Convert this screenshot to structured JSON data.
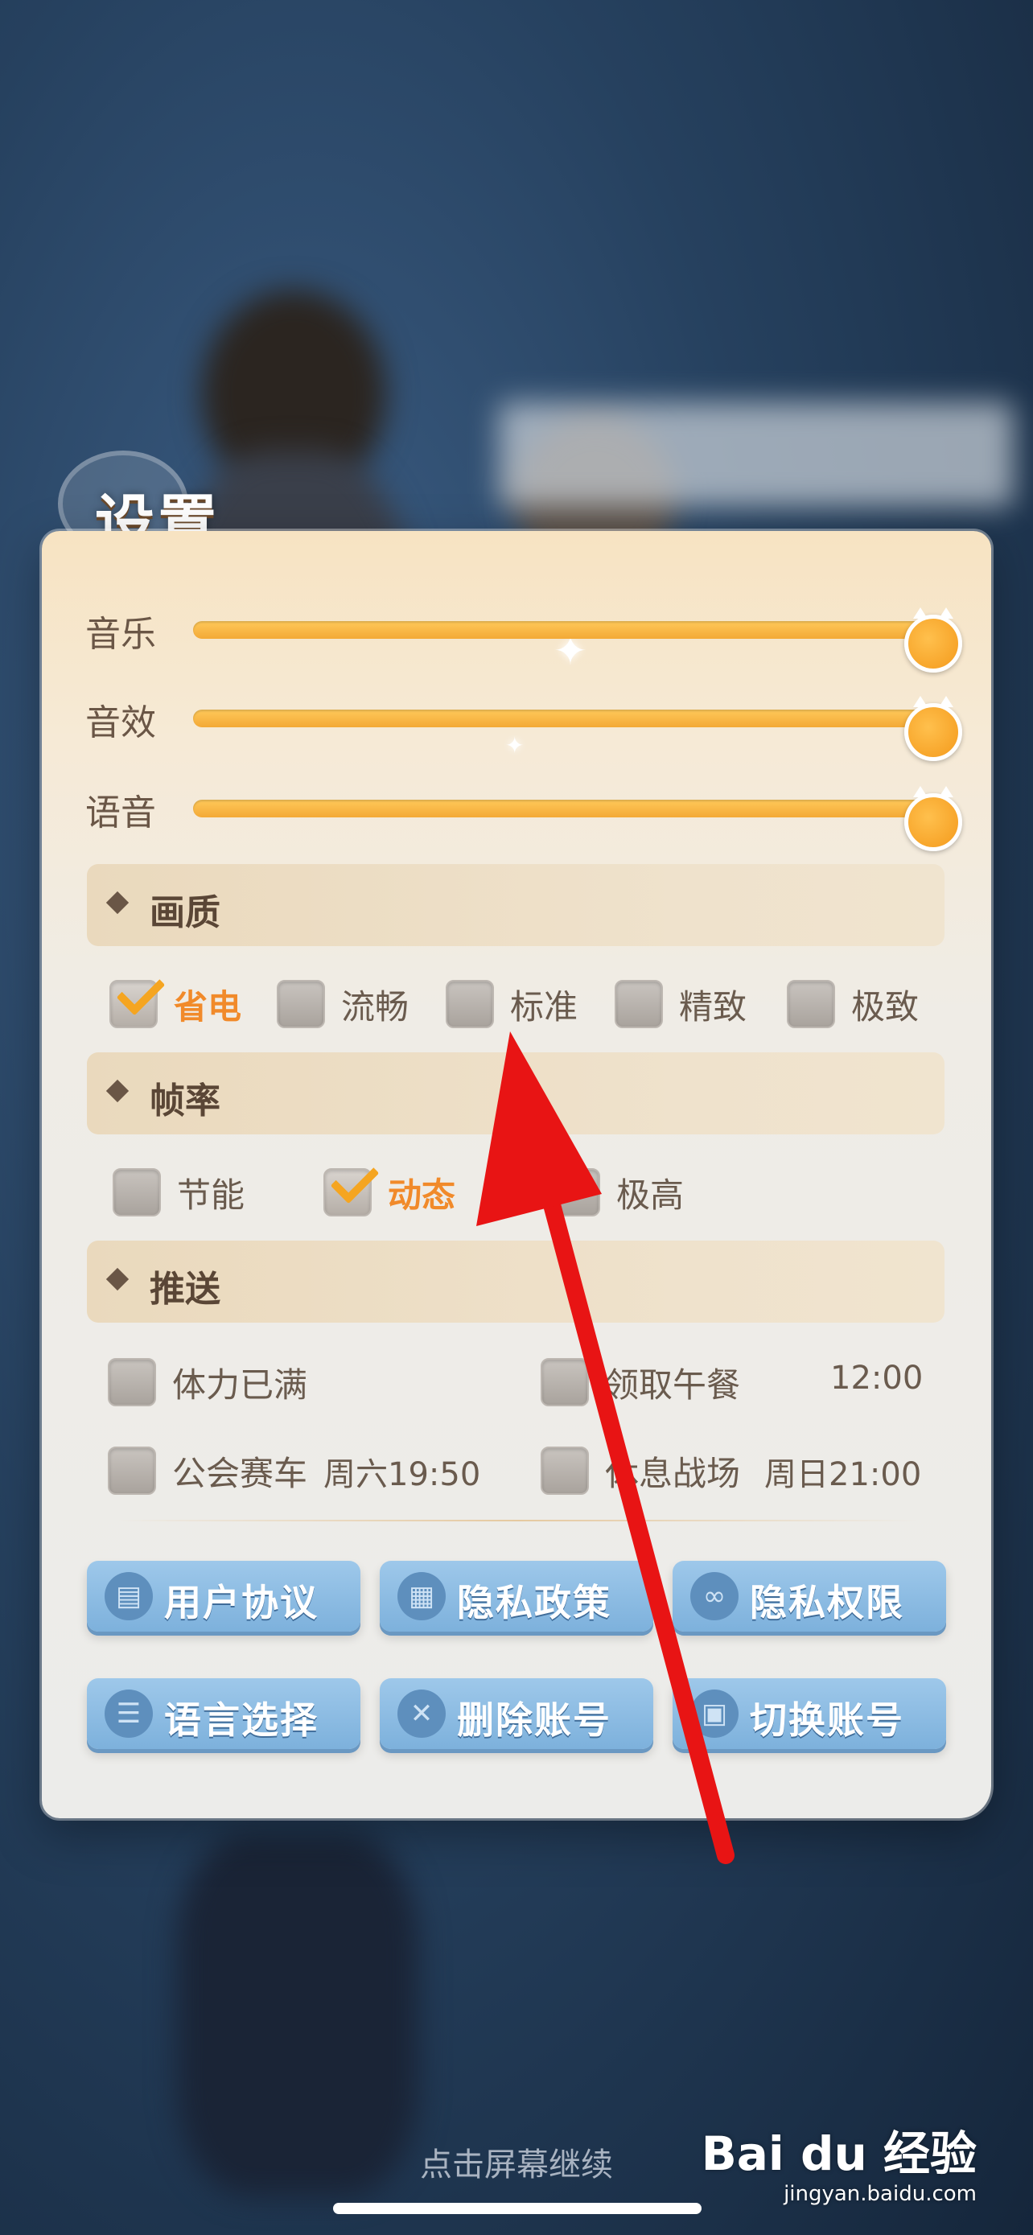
{
  "colors": {
    "accent": "#f5a521",
    "active_text": "#f18a2a",
    "arrow": "#e81414",
    "button": "#8cbce4"
  },
  "title": "设置",
  "sliders": [
    {
      "label": "音乐",
      "value_percent": 100
    },
    {
      "label": "音效",
      "value_percent": 100
    },
    {
      "label": "语音",
      "value_percent": 100
    }
  ],
  "quality": {
    "title": "画质",
    "options": [
      {
        "label": "省电",
        "checked": true
      },
      {
        "label": "流畅",
        "checked": false
      },
      {
        "label": "标准",
        "checked": false
      },
      {
        "label": "精致",
        "checked": false
      },
      {
        "label": "极致",
        "checked": false
      }
    ]
  },
  "framerate": {
    "title": "帧率",
    "options": [
      {
        "label": "节能",
        "checked": false
      },
      {
        "label": "动态",
        "checked": true
      },
      {
        "label": "极高",
        "checked": false
      }
    ]
  },
  "push": {
    "title": "推送",
    "items": [
      {
        "label": "体力已满",
        "time": "",
        "checked": false
      },
      {
        "label": "领取午餐",
        "time": "12:00",
        "checked": false
      },
      {
        "label": "公会赛车",
        "time": "周六19:50",
        "checked": false
      },
      {
        "label": "休息战场",
        "time": "周日21:00",
        "checked": false
      }
    ]
  },
  "buttons": [
    {
      "label": "用户协议",
      "icon": "document-icon"
    },
    {
      "label": "隐私政策",
      "icon": "grid-icon"
    },
    {
      "label": "隐私权限",
      "icon": "link-icon"
    },
    {
      "label": "语言选择",
      "icon": "chat-icon"
    },
    {
      "label": "删除账号",
      "icon": "close-icon"
    },
    {
      "label": "切换账号",
      "icon": "id-card-icon"
    }
  ],
  "footer": {
    "continue_text": "点击屏幕继续"
  },
  "watermark": {
    "brand": "Bai du 经验",
    "url": "jingyan.baidu.com"
  }
}
